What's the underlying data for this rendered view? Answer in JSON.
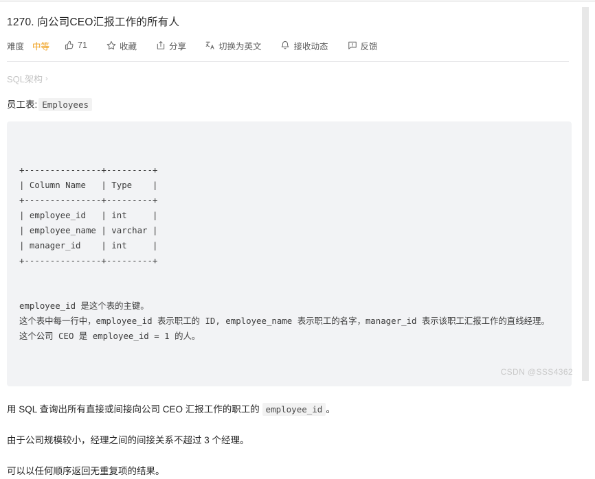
{
  "question": {
    "title": "1270. 向公司CEO汇报工作的所有人"
  },
  "toolbar": {
    "difficulty_label": "难度",
    "difficulty_value": "中等",
    "like_count": "71",
    "favorite_label": "收藏",
    "share_label": "分享",
    "translate_label": "切换为英文",
    "subscribe_label": "接收动态",
    "feedback_label": "反馈",
    "icons": {
      "like": "thumbs-up-icon",
      "favorite": "star-icon",
      "share": "share-icon",
      "translate": "translate-icon",
      "subscribe": "bell-icon",
      "feedback": "feedback-icon"
    }
  },
  "breadcrumb": {
    "label": "SQL架构",
    "separator": "›"
  },
  "schema": {
    "table_label": "员工表:",
    "table_name": "Employees",
    "ascii_table": "+---------------+---------+\n| Column Name   | Type    |\n+---------------+---------+\n| employee_id   | int     |\n| employee_name | varchar |\n| manager_id    | int     |\n+---------------+---------+",
    "notes": "employee_id 是这个表的主键。\n这个表中每一行中，employee_id 表示职工的 ID, employee_name 表示职工的名字，manager_id 表示该职工汇报工作的直线经理。\n这个公司 CEO 是 employee_id = 1 的人。"
  },
  "description": {
    "paragraph_1": "用 SQL 查询出所有直接或间接向公司 CEO 汇报工作的职工的",
    "paragraph_1_code": "employee_id",
    "paragraph_1_tail": "。",
    "paragraph_2": "由于公司规模较小，经理之间的间接关系不超过 3 个经理。",
    "paragraph_3": "可以以任何顺序返回无重复项的结果。"
  },
  "watermark": {
    "text": "CSDN @SSS4362"
  },
  "colors": {
    "accent_orange": "#ef9c14",
    "code_bg": "#f2f3f5",
    "text": "#262626",
    "muted": "#5c5c5c"
  }
}
